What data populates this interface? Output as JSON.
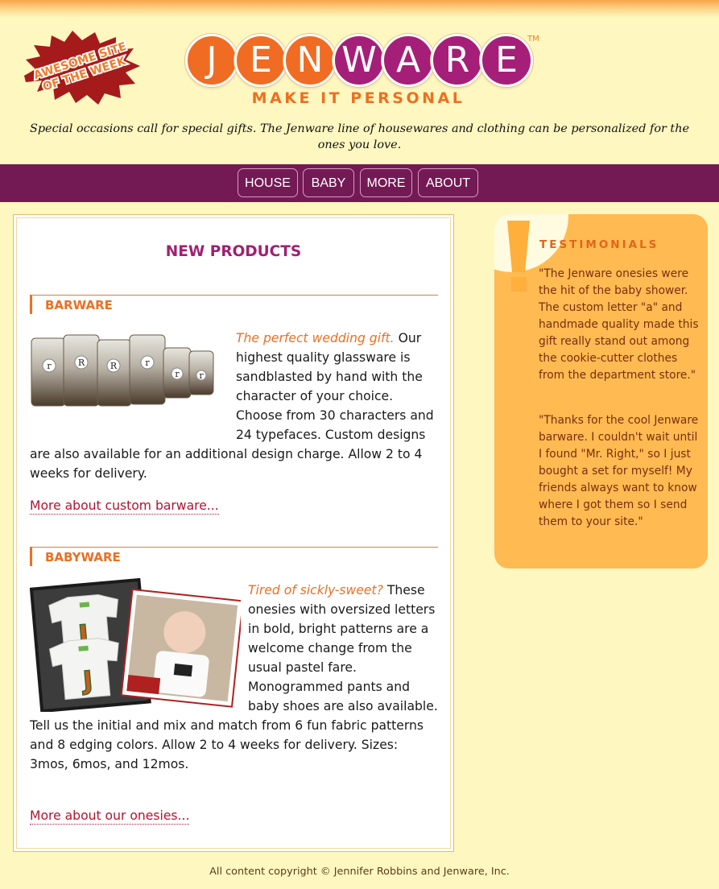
{
  "badge": {
    "line1": "AWESOME SITE",
    "line2": "OF THE WEEK"
  },
  "logo": {
    "letters": [
      "J",
      "E",
      "N",
      "W",
      "A",
      "R",
      "E"
    ],
    "trademark": "TM"
  },
  "tagline": "MAKE IT PERSONAL",
  "intro": "Special occasions call for special gifts. The Jenware line of housewares and clothing can be personalized for the ones you love.",
  "nav": {
    "items": [
      "HOUSE",
      "BABY",
      "MORE",
      "ABOUT"
    ]
  },
  "main": {
    "heading": "NEW PRODUCTS",
    "sections": [
      {
        "title": "BARWARE",
        "lead": "The perfect wedding gift.",
        "body": " Our highest quality glassware is sandblasted by hand with the character of your choice. Choose from 30 characters and 24 typefaces. Custom designs are also available for an additional design charge. Allow 2 to 4 weeks for delivery.",
        "link": "More about custom barware..."
      },
      {
        "title": "BABYWARE",
        "lead": "Tired of sickly-sweet?",
        "body": " These onesies with oversized letters in bold, bright patterns are a welcome change from the usual pastel fare. Monogrammed pants and baby shoes are also available. Tell us the initial and mix and match from 6 fun fabric patterns and 8 edging colors. Allow 2 to 4 weeks for delivery. Sizes: 3mos, 6mos, and 12mos.",
        "link": "More about our onesies..."
      }
    ]
  },
  "sidebar": {
    "heading": "TESTIMONIALS",
    "quotes": [
      "\"The Jenware onesies were the hit of the baby shower. The custom letter \"a\" and handmade quality made this gift really stand out among the cookie-cutter clothes from the department store.\"",
      "\"Thanks for the cool Jenware barware. I couldn't wait until I found \"Mr. Right,\" so I just bought a set for myself! My friends always want to know where I got them so I send them to your site.\""
    ]
  },
  "footer": "All content copyright © Jennifer Robbins and Jenware, Inc.",
  "colors": {
    "background": "#fff7c0",
    "nav_bar": "#731a55",
    "orange": "#ed6f21",
    "purple": "#a01f73",
    "sidebar": "#ffba52",
    "link": "#b3122f"
  }
}
